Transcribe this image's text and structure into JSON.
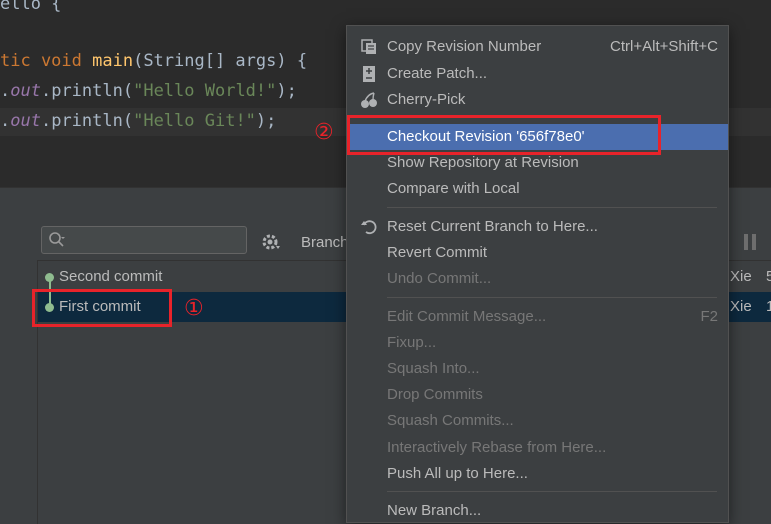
{
  "editor": {
    "lines": [
      {
        "a": "ello {"
      },
      {
        "kw": "tic void ",
        "fn": "main",
        "rest": "(String[] args) {"
      },
      {
        "dot": ".",
        "field": "out",
        "mid": ".println(",
        "str": "\"Hello World!\"",
        "end": ");"
      },
      {
        "dot": ".",
        "field": "out",
        "mid": ".println(",
        "str": "\"Hello Git!\"",
        "end": ");"
      }
    ]
  },
  "log": {
    "branch_label": "Branch",
    "commits": [
      {
        "message": "Second commit",
        "author": "Xie",
        "date": "5"
      },
      {
        "message": "First commit",
        "author": "Xie",
        "date": "1"
      }
    ]
  },
  "menu": {
    "items": [
      {
        "label": "Copy Revision Number",
        "shortcut": "Ctrl+Alt+Shift+C",
        "icon": "copy-icon"
      },
      {
        "label": "Create Patch...",
        "icon": "patch-icon"
      },
      {
        "label": "Cherry-Pick",
        "icon": "cherry-icon"
      },
      {
        "label": "Checkout Revision '656f78e0'"
      },
      {
        "label": "Show Repository at Revision"
      },
      {
        "label": "Compare with Local"
      },
      {
        "label": "Reset Current Branch to Here...",
        "icon": "reset-icon"
      },
      {
        "label": "Revert Commit"
      },
      {
        "label": "Undo Commit..."
      },
      {
        "label": "Edit Commit Message...",
        "shortcut": "F2"
      },
      {
        "label": "Fixup..."
      },
      {
        "label": "Squash Into..."
      },
      {
        "label": "Drop Commits"
      },
      {
        "label": "Squash Commits..."
      },
      {
        "label": "Interactively Rebase from Here..."
      },
      {
        "label": "Push All up to Here..."
      },
      {
        "label": "New Branch..."
      }
    ]
  },
  "annotations": {
    "one": "①",
    "two": "②"
  },
  "colors": {
    "highlight": "#4b6eaf",
    "annotation": "#e8232a",
    "selected_row": "#0d293e"
  }
}
